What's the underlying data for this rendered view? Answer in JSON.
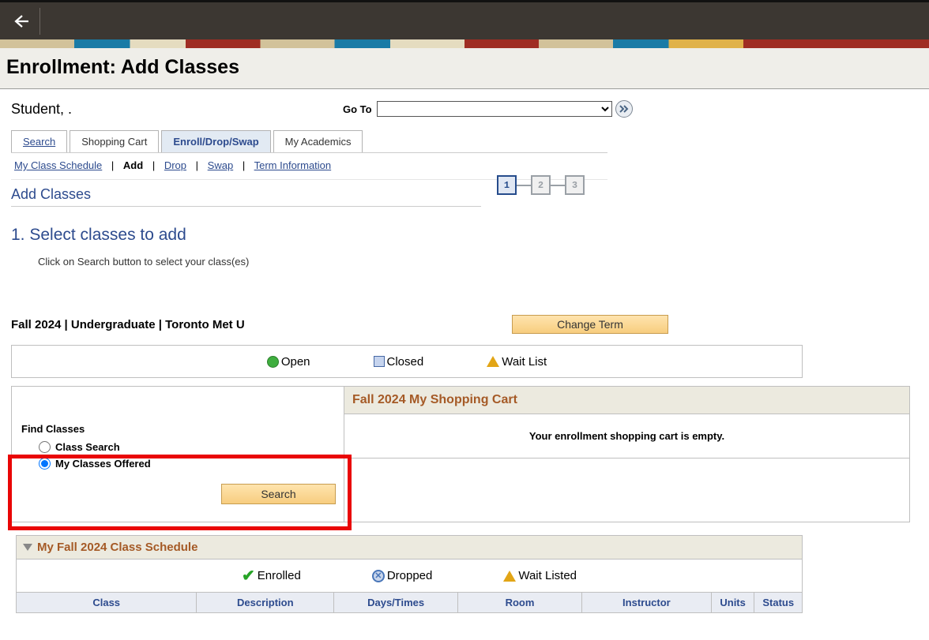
{
  "header": {
    "title": "Enrollment: Add Classes"
  },
  "student_name": "Student, .",
  "goto_label": "Go To",
  "tabs": [
    {
      "label": "Search"
    },
    {
      "label": "Shopping Cart"
    },
    {
      "label": "Enroll/Drop/Swap"
    },
    {
      "label": "My Academics"
    }
  ],
  "active_tab_index": 2,
  "subtabs": {
    "items": [
      "My Class Schedule",
      "Add",
      "Drop",
      "Swap",
      "Term Information"
    ],
    "active_index": 1
  },
  "section_title": "Add Classes",
  "steps": [
    "1",
    "2",
    "3"
  ],
  "active_step": 0,
  "big_step_title": "1.  Select classes to add",
  "instructions": "Click on Search button to select your class(es)",
  "term_line": "Fall 2024 | Undergraduate | Toronto Met U",
  "change_term_label": "Change Term",
  "legend": {
    "open": "Open",
    "closed": "Closed",
    "waitlist": "Wait List"
  },
  "find_classes": {
    "title": "Find Classes",
    "opt_class_search": "Class Search",
    "opt_my_classes": "My Classes Offered",
    "search_button": "Search",
    "selected": "my_classes"
  },
  "cart": {
    "header": "Fall 2024 My Shopping Cart",
    "empty_msg": "Your enrollment shopping cart is empty."
  },
  "schedule": {
    "title": "My Fall 2024 Class Schedule",
    "legend": {
      "enrolled": "Enrolled",
      "dropped": "Dropped",
      "waitlisted": "Wait Listed"
    },
    "columns": [
      "Class",
      "Description",
      "Days/Times",
      "Room",
      "Instructor",
      "Units",
      "Status"
    ]
  }
}
